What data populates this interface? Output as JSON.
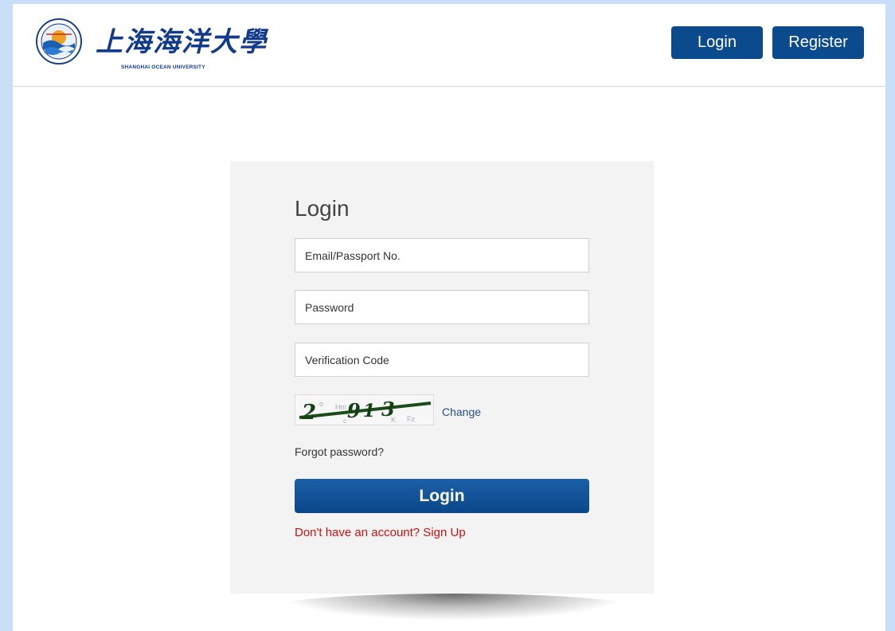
{
  "header": {
    "logo_cn": "上海海洋大學",
    "logo_en": "SHANGHAI OCEAN UNIVERSITY",
    "login_label": "Login",
    "register_label": "Register"
  },
  "login_form": {
    "title": "Login",
    "email_placeholder": "Email/Passport No.",
    "password_placeholder": "Password",
    "verification_placeholder": "Verification Code",
    "change_label": "Change",
    "forgot_label": "Forgot password?",
    "submit_label": "Login",
    "signup_label": "Don't have an account? Sign Up"
  },
  "colors": {
    "primary": "#0b4a8d",
    "background": "#c9def7",
    "card": "#f3f3f3",
    "signup": "#d01010"
  },
  "icons": {
    "logo": "university-emblem-icon",
    "captcha": "captcha-image"
  }
}
